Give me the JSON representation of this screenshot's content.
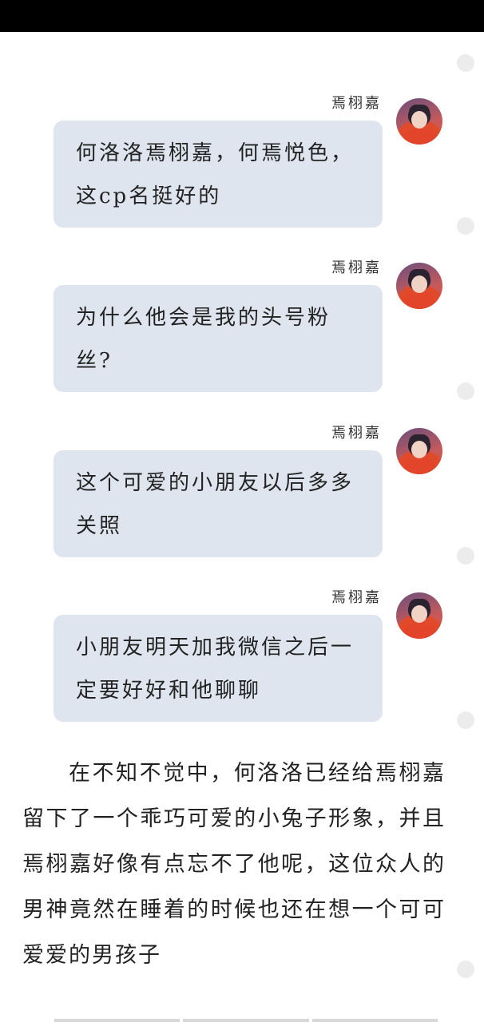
{
  "messages": [
    {
      "sender": "焉栩嘉",
      "text": "何洛洛焉栩嘉，何焉悦色，这cp名挺好的"
    },
    {
      "sender": "焉栩嘉",
      "text": "为什么他会是我的头号粉丝?"
    },
    {
      "sender": "焉栩嘉",
      "text": "这个可爱的小朋友以后多多关照"
    },
    {
      "sender": "焉栩嘉",
      "text": "小朋友明天加我微信之后一定要好好和他聊聊"
    }
  ],
  "narrative": "在不知不觉中，何洛洛已经给焉栩嘉留下了一个乖巧可爱的小兔子形象，并且焉栩嘉好像有点忘不了他呢，这位众人的男神竟然在睡着的时候也还在想一个可可爱爱的男孩子"
}
